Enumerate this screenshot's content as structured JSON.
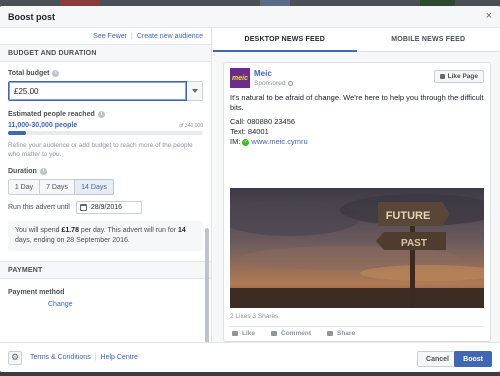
{
  "dialog": {
    "title": "Boost post",
    "close_glyph": "×",
    "see_fewer": "See Fewer",
    "create_audience": "Create new audience"
  },
  "budget": {
    "section_title": "BUDGET AND DURATION",
    "total_label": "Total budget",
    "total_value": "£25.00",
    "reach_label": "Estimated people reached",
    "reach_value": "11,000-30,000 people",
    "reach_of": "of 340,000",
    "reach_fraction": 0.09,
    "hint": "Refine your audience or add budget to reach more of the people who matter to you.",
    "duration_label": "Duration",
    "durations": [
      "1 Day",
      "7 Days",
      "14 Days"
    ],
    "duration_selected": 2,
    "run_until_label": "Run this advert until",
    "run_until_date": "28/9/2016",
    "spend_pre": "You will spend ",
    "spend_amount": "£1.78",
    "spend_mid": " per day. This advert will run for ",
    "spend_days": "14",
    "spend_post": " days, ending on 28 September 2016."
  },
  "payment": {
    "section_title": "PAYMENT",
    "method_label": "Payment method",
    "change": "Change"
  },
  "preview": {
    "tabs": [
      "DESKTOP NEWS FEED",
      "MOBILE NEWS FEED"
    ],
    "active_tab": 0,
    "page_name": "Meic",
    "logo_text": "meic",
    "sponsored": "Sponsored",
    "like_page": "Like Page",
    "text1": "It's natural to be afraid of change. We're here to help you through the difficult bits.",
    "call": "Call: 080880 23456",
    "text": "Text: 84001",
    "im_label": "IM:",
    "im_link": "www.meic.cymru",
    "sign_top": "FUTURE",
    "sign_bottom": "PAST",
    "stats": "2 Likes  3 Shares",
    "actions": [
      "Like",
      "Comment",
      "Share"
    ]
  },
  "footer": {
    "terms": "Terms & Conditions",
    "help": "Help Centre",
    "cancel": "Cancel",
    "boost": "Boost"
  },
  "colors": {
    "accent": "#4267b2",
    "brand_purple": "#6e2c8a"
  },
  "icons": [
    "close-icon",
    "info-icon",
    "chevron-down-icon",
    "calendar-icon",
    "globe-icon",
    "thumb-icon",
    "check-icon",
    "gear-icon",
    "comment-icon",
    "share-icon"
  ]
}
